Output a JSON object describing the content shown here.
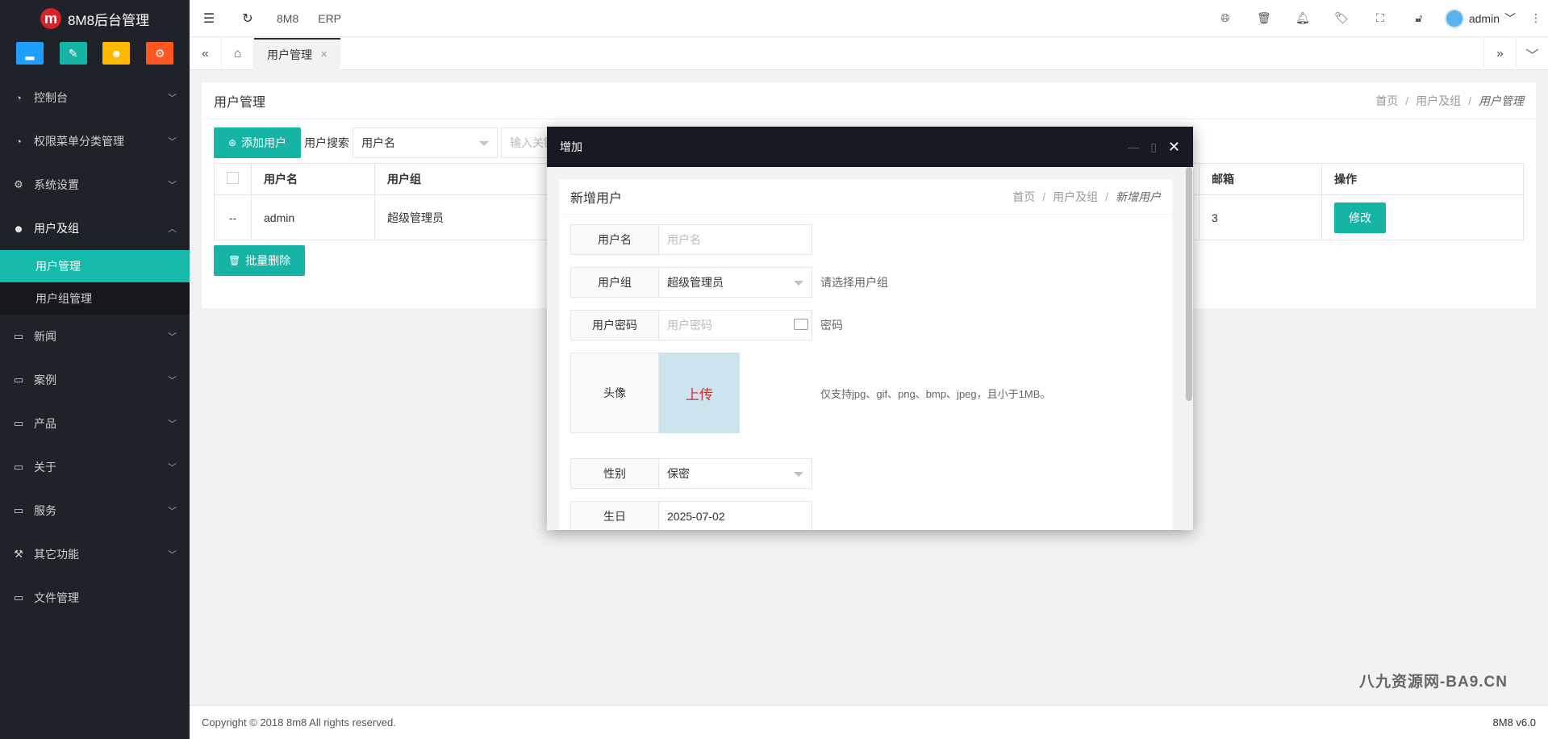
{
  "app": {
    "title": "8M8后台管理",
    "logo_letter": "m"
  },
  "quick_buttons": [
    {
      "icon": "chart-icon",
      "color": "#1e9fff",
      "glyph": "▂"
    },
    {
      "icon": "pencil-icon",
      "color": "#16b4a5",
      "glyph": "✎"
    },
    {
      "icon": "users-icon",
      "color": "#ffb800",
      "glyph": "☻"
    },
    {
      "icon": "settings-icon",
      "color": "#ff5722",
      "glyph": "⚙"
    }
  ],
  "sidebar": {
    "items": [
      {
        "label": "控制台",
        "icon": "dashboard-icon",
        "glyph": "◔",
        "expanded": false
      },
      {
        "label": "权限菜单分类管理",
        "icon": "dashboard-icon",
        "glyph": "◔",
        "expanded": false
      },
      {
        "label": "系统设置",
        "icon": "gear-icon",
        "glyph": "⚙",
        "expanded": false
      },
      {
        "label": "用户及组",
        "icon": "users-icon",
        "glyph": "☻",
        "expanded": true,
        "children": [
          {
            "label": "用户管理",
            "active": true
          },
          {
            "label": "用户组管理",
            "active": false
          }
        ]
      },
      {
        "label": "新闻",
        "icon": "monitor-icon",
        "glyph": "▭",
        "expanded": false
      },
      {
        "label": "案例",
        "icon": "monitor-icon",
        "glyph": "▭",
        "expanded": false
      },
      {
        "label": "产品",
        "icon": "monitor-icon",
        "glyph": "▭",
        "expanded": false
      },
      {
        "label": "关于",
        "icon": "monitor-icon",
        "glyph": "▭",
        "expanded": false
      },
      {
        "label": "服务",
        "icon": "monitor-icon",
        "glyph": "▭",
        "expanded": false
      },
      {
        "label": "其它功能",
        "icon": "hammer-icon",
        "glyph": "⚒",
        "expanded": false
      },
      {
        "label": "文件管理",
        "icon": "monitor-icon",
        "glyph": "▭",
        "expanded": false
      }
    ]
  },
  "header": {
    "links": [
      "8M8",
      "ERP"
    ],
    "user": "admin"
  },
  "tabs": {
    "active_label": "用户管理"
  },
  "page": {
    "title": "用户管理",
    "breadcrumb": [
      "首页",
      "用户及组",
      "用户管理"
    ],
    "toolbar": {
      "add_label": "添加用户",
      "search_label": "用户搜索",
      "search_select": "用户名",
      "search_placeholder": "输入关键字"
    },
    "table": {
      "columns": [
        "用户名",
        "用户组",
        "邮箱",
        "操作"
      ],
      "rows": [
        {
          "check": "--",
          "name": "admin",
          "group": "超级管理员",
          "email": "3",
          "action": "修改"
        }
      ]
    },
    "batch_delete_label": "批量删除"
  },
  "modal": {
    "title": "增加",
    "inner_title": "新增用户",
    "breadcrumb": [
      "首页",
      "用户及组",
      "新增用户"
    ],
    "fields": {
      "username": {
        "label": "用户名",
        "placeholder": "用户名"
      },
      "group": {
        "label": "用户组",
        "value": "超级管理员",
        "hint": "请选择用户组"
      },
      "password": {
        "label": "用户密码",
        "placeholder": "用户密码",
        "hint": "密码"
      },
      "avatar": {
        "label": "头像",
        "upload": "上传",
        "hint": "仅支持jpg、gif、png、bmp、jpeg，且小于1MB。"
      },
      "gender": {
        "label": "性别",
        "value": "保密"
      },
      "birthday": {
        "label": "生日",
        "value": "2025-07-02"
      }
    }
  },
  "footer": {
    "copyright": "Copyright © 2018 8m8 All rights reserved.",
    "version": "8M8 v6.0"
  },
  "watermark": "八九资源网-BA9.CN"
}
